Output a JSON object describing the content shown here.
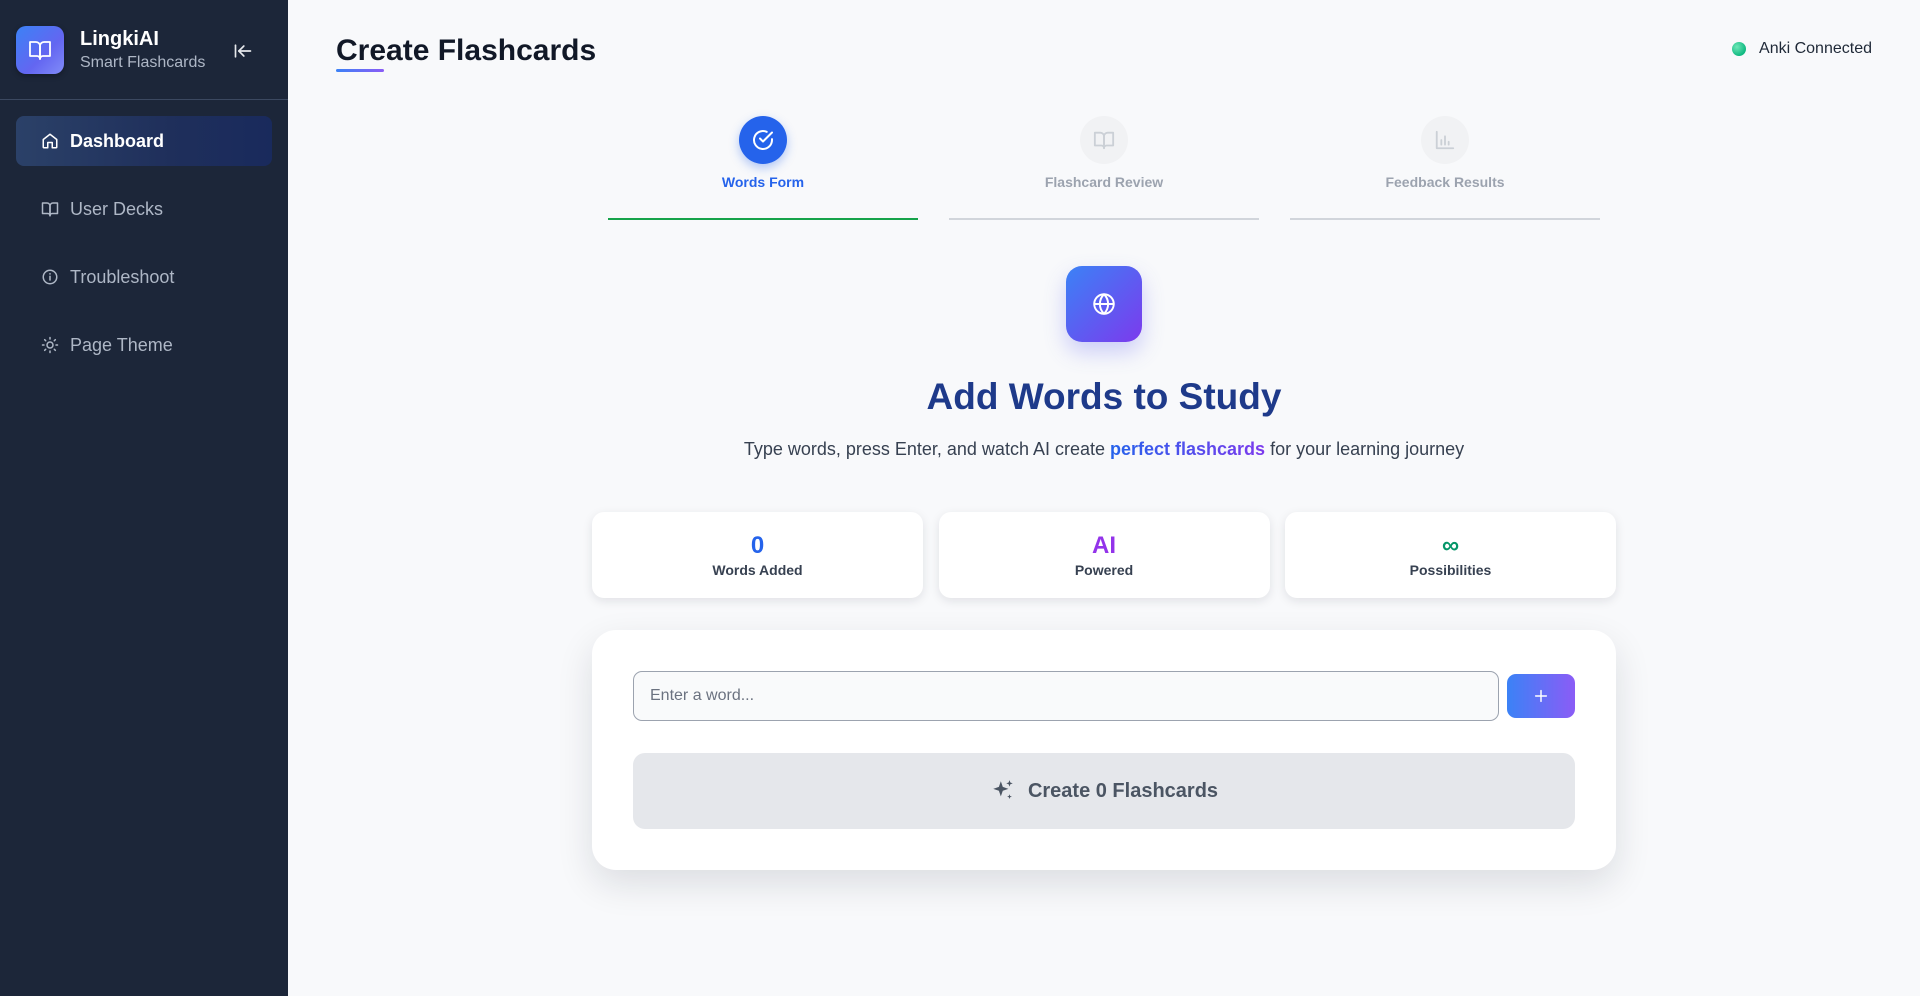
{
  "brand": {
    "name": "LingkiAI",
    "subtitle": "Smart Flashcards",
    "logo_icon": "book-open-icon",
    "collapse_icon": "arrow-left-to-line-icon"
  },
  "sidebar": {
    "items": [
      {
        "label": "Dashboard",
        "icon": "home-icon",
        "active": true
      },
      {
        "label": "User Decks",
        "icon": "book-icon",
        "active": false
      },
      {
        "label": "Troubleshoot",
        "icon": "info-icon",
        "active": false
      },
      {
        "label": "Page Theme",
        "icon": "sun-icon",
        "active": false
      }
    ]
  },
  "header": {
    "title": "Create Flashcards",
    "status_text": "Anki Connected",
    "status_color": "#10b981"
  },
  "steps": [
    {
      "label": "Words Form",
      "icon": "check-circle-icon",
      "active": true
    },
    {
      "label": "Flashcard Review",
      "icon": "book-open-icon",
      "active": false
    },
    {
      "label": "Feedback Results",
      "icon": "bar-chart-icon",
      "active": false
    }
  ],
  "hero": {
    "icon": "globe-icon",
    "title": "Add Words to Study",
    "subtitle_before": "Type words, press Enter, and watch AI create ",
    "subtitle_highlight": "perfect flashcards",
    "subtitle_after": " for your learning journey"
  },
  "stats": [
    {
      "value": "0",
      "label": "Words Added",
      "color": "#2563eb"
    },
    {
      "value": "AI",
      "label": "Powered",
      "color": "#9333ea"
    },
    {
      "value": "∞",
      "label": "Possibilities",
      "color": "#059669"
    }
  ],
  "form": {
    "input_value": "",
    "input_placeholder": "Enter a word...",
    "add_icon": "plus-icon",
    "create_label": "Create 0 Flashcards",
    "create_icon": "sparkles-icon"
  },
  "colors": {
    "sidebar_bg": "#1c2639",
    "accent_blue": "#2563eb",
    "accent_purple": "#7c3aed",
    "step_done": "#16a34a"
  }
}
